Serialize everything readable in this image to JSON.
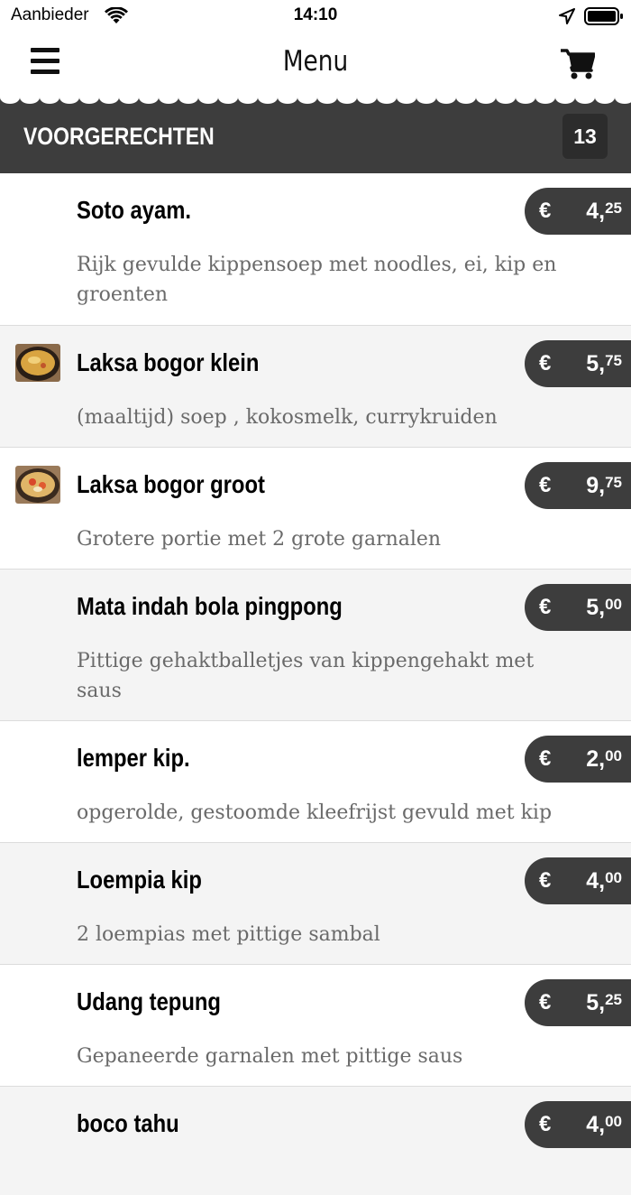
{
  "status_bar": {
    "carrier": "Aanbieder",
    "time": "14:10"
  },
  "nav": {
    "title": "Menu"
  },
  "category": {
    "title": "VOORGERECHTEN",
    "count": "13"
  },
  "items": [
    {
      "name": "Soto ayam.",
      "description": "Rijk gevulde kippensoep met noodles, ei, kip en groenten",
      "currency": "€",
      "price_whole": "4,",
      "price_cents": "25"
    },
    {
      "name": "Laksa bogor klein",
      "description": "(maaltijd) soep , kokosmelk, currykruiden",
      "currency": "€",
      "price_whole": "5,",
      "price_cents": "75"
    },
    {
      "name": "Laksa bogor groot",
      "description": "Grotere portie met 2 grote garnalen",
      "currency": "€",
      "price_whole": "9,",
      "price_cents": "75"
    },
    {
      "name": "Mata indah bola pingpong",
      "description": "Pittige gehaktballetjes van kippengehakt met saus",
      "currency": "€",
      "price_whole": "5,",
      "price_cents": "00"
    },
    {
      "name": "lemper kip.",
      "description": "opgerolde, gestoomde kleefrijst gevuld met kip",
      "currency": "€",
      "price_whole": "2,",
      "price_cents": "00"
    },
    {
      "name": "Loempia kip",
      "description": "2 loempias met pittige sambal",
      "currency": "€",
      "price_whole": "4,",
      "price_cents": "00"
    },
    {
      "name": "Udang tepung",
      "description": "Gepaneerde garnalen met pittige saus",
      "currency": "€",
      "price_whole": "5,",
      "price_cents": "25"
    },
    {
      "name": "boco tahu",
      "description": "",
      "currency": "€",
      "price_whole": "4,",
      "price_cents": "00"
    }
  ],
  "icons": {
    "menu": "hamburger-icon",
    "cart": "cart-icon",
    "wifi": "wifi-icon",
    "location": "location-arrow-icon",
    "battery": "battery-icon"
  },
  "colors": {
    "header_bg": "#3d3d3d",
    "price_bg": "#3d3d3d",
    "alt_row": "#f4f4f4",
    "desc_text": "#6a6a6a"
  }
}
